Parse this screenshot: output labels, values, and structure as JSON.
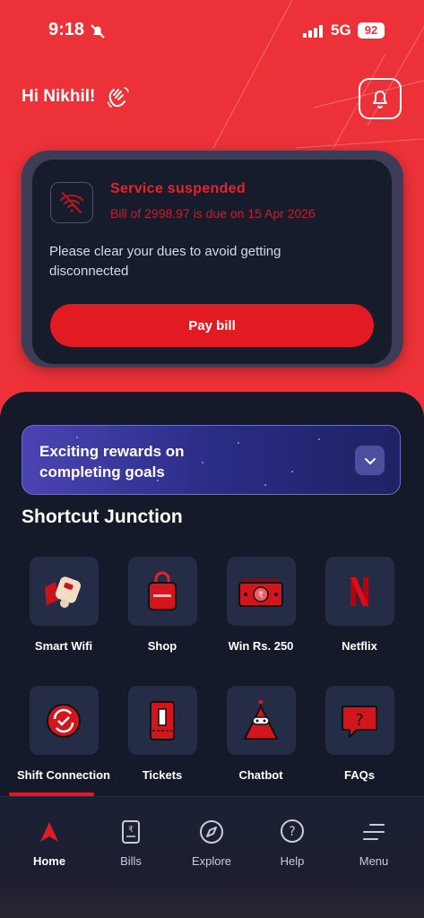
{
  "status_bar": {
    "time": "9:18",
    "network": "5G",
    "battery": "92"
  },
  "header": {
    "greeting": "Hi Nikhil!"
  },
  "alert_card": {
    "title": "Service suspended",
    "due_text": "Bill of 2998.97 is due on 15 Apr 2026",
    "message": "Please clear your dues to avoid getting disconnected",
    "pay_label": "Pay bill"
  },
  "rewards": {
    "text": "Exciting rewards on completing goals"
  },
  "shortcuts": {
    "title": "Shortcut Junction",
    "items": [
      {
        "label": "Smart Wifi",
        "icon": "smart-wifi-icon"
      },
      {
        "label": "Shop",
        "icon": "shopping-bag-icon"
      },
      {
        "label": "Win Rs. 250",
        "icon": "money-icon"
      },
      {
        "label": "Netflix",
        "icon": "netflix-icon"
      },
      {
        "label": "Shift Connection",
        "icon": "shift-connection-icon"
      },
      {
        "label": "Tickets",
        "icon": "tickets-icon"
      },
      {
        "label": "Chatbot",
        "icon": "chatbot-icon"
      },
      {
        "label": "FAQs",
        "icon": "faq-icon"
      }
    ]
  },
  "bottom_nav": {
    "items": [
      {
        "label": "Home",
        "icon": "home-icon",
        "active": true
      },
      {
        "label": "Bills",
        "icon": "bills-icon"
      },
      {
        "label": "Explore",
        "icon": "explore-icon"
      },
      {
        "label": "Help",
        "icon": "help-icon"
      },
      {
        "label": "Menu",
        "icon": "menu-icon"
      }
    ]
  },
  "colors": {
    "brand_red": "#ec3238",
    "dark_bg": "#151a2b",
    "card_bg": "#161c2c",
    "tile_bg": "#252d46"
  }
}
